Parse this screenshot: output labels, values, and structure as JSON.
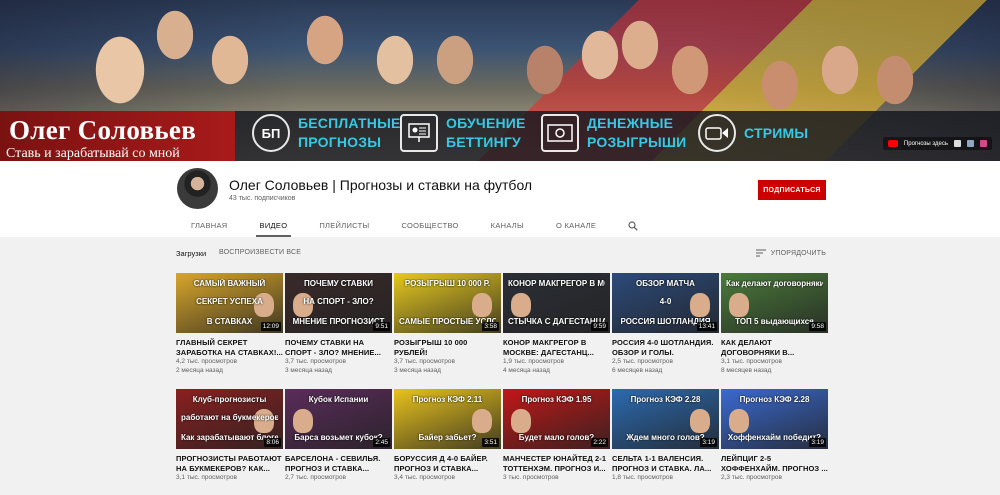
{
  "banner": {
    "name": "Олег Соловьев",
    "tagline": "Ставь и зарабатывай со мной",
    "promos": [
      {
        "icon": "bp-icon",
        "icon_text": "БП",
        "lines": [
          "БЕСПЛАТНЫЕ",
          "ПРОГНОЗЫ"
        ]
      },
      {
        "icon": "presentation-icon",
        "icon_text": "",
        "lines": [
          "ОБУЧЕНИЕ",
          "БЕТТИНГУ"
        ]
      },
      {
        "icon": "money-icon",
        "icon_text": "",
        "lines": [
          "ДЕНЕЖНЫЕ",
          "РОЗЫГРЫШИ"
        ]
      },
      {
        "icon": "video-camera-icon",
        "icon_text": "",
        "lines": [
          "СТРИМЫ"
        ]
      }
    ],
    "link_label": "Прогнозы здесь"
  },
  "channel": {
    "title": "Олег Соловьев | Прогнозы и ставки на футбол",
    "subscribers": "43 тыс. подписчиков",
    "subscribe_label": "ПОДПИСАТЬСЯ"
  },
  "tabs": [
    {
      "label": "ГЛАВНАЯ",
      "active": false
    },
    {
      "label": "ВИДЕО",
      "active": true
    },
    {
      "label": "ПЛЕЙЛИСТЫ",
      "active": false
    },
    {
      "label": "СООБЩЕСТВО",
      "active": false
    },
    {
      "label": "КАНАЛЫ",
      "active": false
    },
    {
      "label": "О КАНАЛЕ",
      "active": false
    }
  ],
  "uploads": {
    "label": "Загрузки",
    "play_all": "ВОСПРОИЗВЕСТИ ВСЕ",
    "sort": "УПОРЯДОЧИТЬ"
  },
  "videos": [
    {
      "title": "ГЛАВНЫЙ СЕКРЕТ ЗАРАБОТКА НА СТАВКАХ!...",
      "views": "4,2 тыс. просмотров",
      "age": "2 месяца назад",
      "duration": "12:09",
      "thumb_lines": [
        "САМЫЙ ВАЖНЫЙ",
        "СЕКРЕТ УСПЕХА",
        "В СТАВКАХ"
      ],
      "bg": "#d8a62a"
    },
    {
      "title": "ПОЧЕМУ СТАВКИ НА СПОРТ - ЗЛО? МНЕНИЕ...",
      "views": "3,7 тыс. просмотров",
      "age": "3 месяца назад",
      "duration": "9:51",
      "thumb_lines": [
        "ПОЧЕМУ СТАВКИ",
        "НА СПОРТ - ЗЛО?",
        "МНЕНИЕ ПРОГНОЗИСТ"
      ],
      "bg": "#3a2a2a"
    },
    {
      "title": "РОЗЫГРЫШ 10 000 РУБЛЕЙ!",
      "views": "3,7 тыс. просмотров",
      "age": "3 месяца назад",
      "duration": "3:58",
      "thumb_lines": [
        "РОЗЫГРЫШ 10 000 Р.",
        "",
        "САМЫЕ ПРОСТЫЕ УСЛОВИЯ"
      ],
      "bg": "#e6c81e"
    },
    {
      "title": "КОНОР МАКГРЕГОР В МОСКВЕ: ДАГЕСТАНЦ...",
      "views": "1,9 тыс. просмотров",
      "age": "4 месяца назад",
      "duration": "9:59",
      "thumb_lines": [
        "КОНОР МАКГРЕГОР В МОСКВЕ",
        "",
        "СТЫЧКА С ДАГЕСТАНЦАМИ!"
      ],
      "bg": "#2b2f36"
    },
    {
      "title": "РОССИЯ 4-0 ШОТЛАНДИЯ. ОБЗОР И ГОЛЫ. ИНТЕРВЬ...",
      "views": "2,5 тыс. просмотров",
      "age": "6 месяцев назад",
      "duration": "13:41",
      "thumb_lines": [
        "ОБЗОР МАТЧА",
        "4-0",
        "РОССИЯ ШОТЛАНДИЯ"
      ],
      "bg": "#2c4a7a"
    },
    {
      "title": "КАК ДЕЛАЮТ ДОГОВОРНЯКИ В...",
      "views": "3,1 тыс. просмотров",
      "age": "8 месяцев назад",
      "duration": "9:58",
      "thumb_lines": [
        "Как делают договорняки",
        "",
        "ТОП 5 выдающихся"
      ],
      "bg": "#4a7a3a"
    },
    {
      "title": "ПРОГНОЗИСТЫ РАБОТАЮТ НА БУКМЕКЕРОВ? КАК...",
      "views": "3,1 тыс. просмотров",
      "age": "",
      "duration": "8:06",
      "thumb_lines": [
        "Клуб-прогнозисты",
        "работают на букмекеров?",
        "Как зарабатывают блогеры"
      ],
      "bg": "#8a2020"
    },
    {
      "title": "БАРСЕЛОНА - СЕВИЛЬЯ. ПРОГНОЗ И СТАВКА...",
      "views": "2,7 тыс. просмотров",
      "age": "",
      "duration": "2:45",
      "thumb_lines": [
        "Кубок Испании",
        "",
        "Барса возьмет кубок?"
      ],
      "bg": "#5a2c5a"
    },
    {
      "title": "БОРУССИЯ Д 4-0 БАЙЕР. ПРОГНОЗ И СТАВКА...",
      "views": "3,4 тыс. просмотров",
      "age": "",
      "duration": "3:51",
      "thumb_lines": [
        "Прогноз КЭФ 2.11",
        "",
        "Байер забьет?"
      ],
      "bg": "#e8c21c"
    },
    {
      "title": "МАНЧЕСТЕР ЮНАЙТЕД 2-1 ТОТТЕНХЭМ. ПРОГНОЗ И...",
      "views": "3 тыс. просмотров",
      "age": "",
      "duration": "2:22",
      "thumb_lines": [
        "Прогноз КЭФ 1.95",
        "",
        "Будет мало голов?"
      ],
      "bg": "#c01818"
    },
    {
      "title": "СЕЛЬТА 1-1 ВАЛЕНСИЯ. ПРОГНОЗ И СТАВКА. ЛА...",
      "views": "1,8 тыс. просмотров",
      "age": "",
      "duration": "3:19",
      "thumb_lines": [
        "Прогноз КЭФ 2.28",
        "",
        "Ждем много голов?"
      ],
      "bg": "#2c6ab0"
    },
    {
      "title": "ЛЕЙПЦИГ 2-5 ХОФФЕНХАЙМ. ПРОГНОЗ ...",
      "views": "2,3 тыс. просмотров",
      "age": "",
      "duration": "3:19",
      "thumb_lines": [
        "Прогноз КЭФ 2.28",
        "",
        "Хоффенхайм победит?"
      ],
      "bg": "#3a6ad0"
    }
  ],
  "colors": {
    "accent_red": "#cc0000",
    "promo_cyan": "#36c9e6",
    "banner_red": "#a81a1a"
  }
}
